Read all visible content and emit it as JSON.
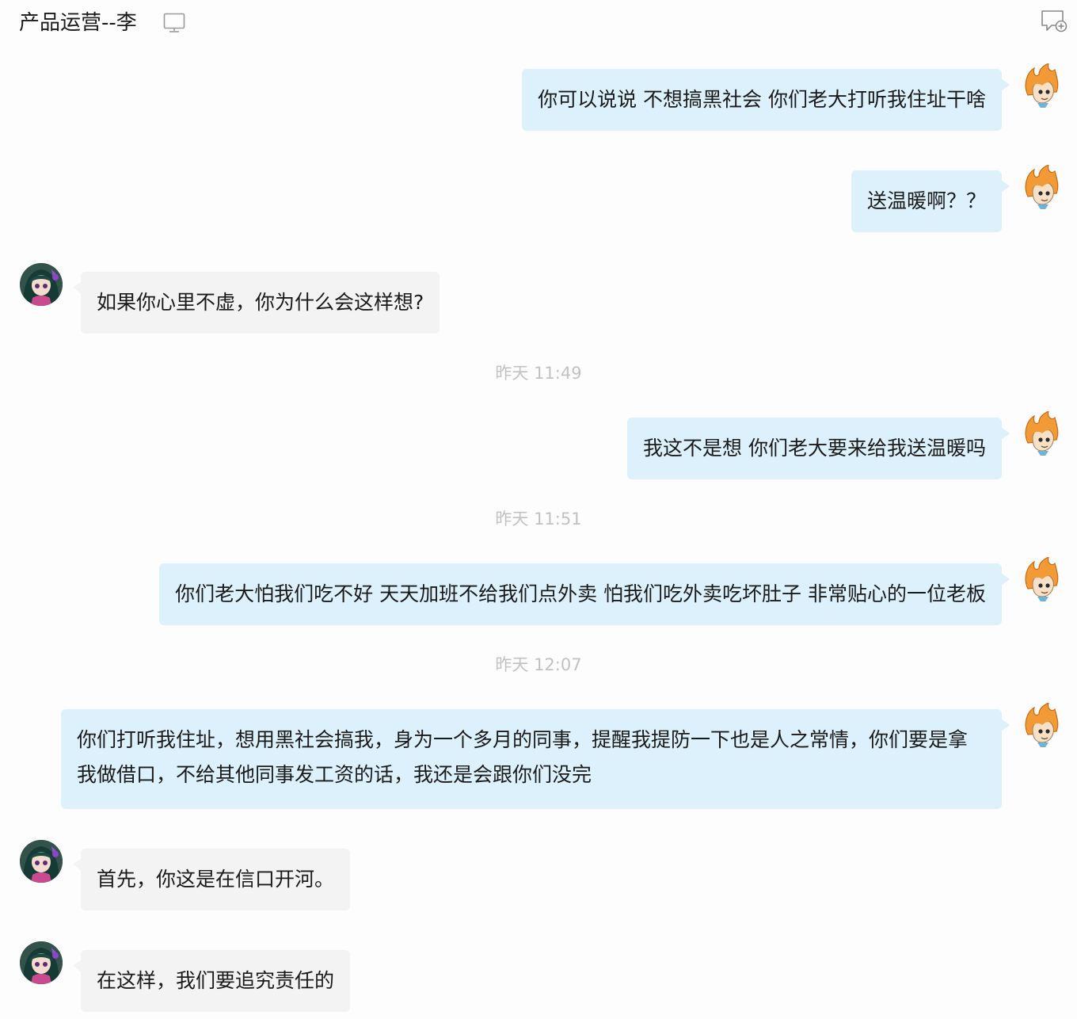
{
  "header": {
    "title": "产品运营--李",
    "icons": [
      "monitor-icon",
      "add-chat-icon"
    ]
  },
  "messages": [
    {
      "side": "out",
      "text": "你可以说说 不想搞黑社会 你们老大打听我住址干啥"
    },
    {
      "side": "out",
      "text": "送温暖啊？？"
    },
    {
      "side": "in",
      "text": "如果你心里不虚，你为什么会这样想?"
    },
    {
      "type": "time",
      "text": "昨天  11:49"
    },
    {
      "side": "out",
      "text": "我这不是想 你们老大要来给我送温暖吗"
    },
    {
      "type": "time",
      "text": "昨天  11:51"
    },
    {
      "side": "out",
      "text": "你们老大怕我们吃不好 天天加班不给我们点外卖 怕我们吃外卖吃坏肚子 非常贴心的一位老板"
    },
    {
      "type": "time",
      "text": "昨天  12:07"
    },
    {
      "side": "out",
      "text": "你们打听我住址，想用黑社会搞我，身为一个多月的同事，提醒我提防一下也是人之常情，你们要是拿我做借口，不给其他同事发工资的话，我还是会跟你们没完"
    },
    {
      "side": "in",
      "text": "首先，你这是在信口开河。"
    },
    {
      "side": "in",
      "text": "在这样，我们要追究责任的"
    }
  ],
  "colors": {
    "outgoing_bubble": "#dcf1fc",
    "incoming_bubble": "#f3f3f3",
    "timestamp": "#c2c2c2",
    "avatar_flame": "#f29a35"
  }
}
